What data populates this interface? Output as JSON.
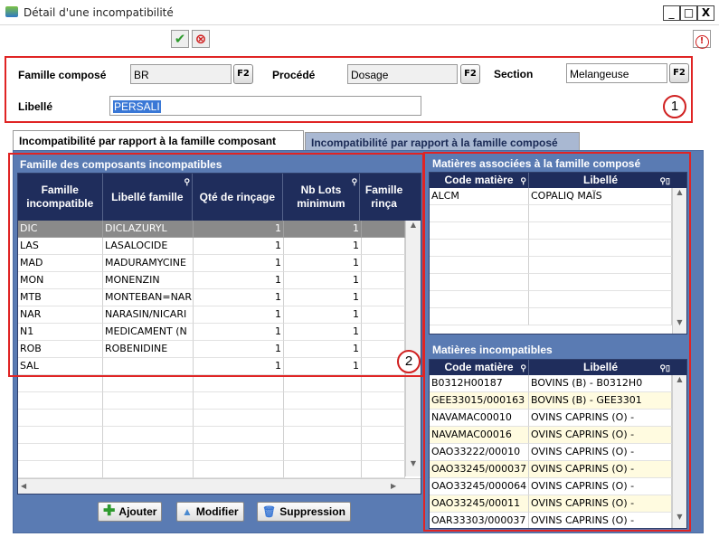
{
  "window": {
    "title": "Détail d'une incompatibilité",
    "minimize": "_",
    "maximize": "□",
    "close": "X"
  },
  "toolbar": {
    "validate_icon": "check-icon",
    "cancel_icon": "cancel-icon",
    "info_icon": "info-icon"
  },
  "header": {
    "famille_label": "Famille composé",
    "famille_value": "BR",
    "procede_label": "Procédé",
    "procede_value": "Dosage",
    "section_label": "Section",
    "section_value": "Melangeuse",
    "libelle_label": "Libellé",
    "libelle_value": "PERSALI",
    "f2": "F2",
    "badge1": "1",
    "badge2": "2"
  },
  "tabs": [
    {
      "label": "Incompatibilité par rapport à la famille composant",
      "active": true
    },
    {
      "label": "Incompatibilité par rapport à la famille composé",
      "active": false
    }
  ],
  "left_grid": {
    "title": "Famille des composants incompatibles",
    "columns": [
      "Famille incompatible",
      "Libellé famille",
      "Qté de rinçage",
      "Nb Lots minimum",
      "Famille rinça"
    ],
    "rows": [
      [
        "DIC",
        "DICLAZURYL",
        "1",
        "1"
      ],
      [
        "LAS",
        "LASALOCIDE",
        "1",
        "1"
      ],
      [
        "MAD",
        "MADURAMYCINE",
        "1",
        "1"
      ],
      [
        "MON",
        "MONENZIN",
        "1",
        "1"
      ],
      [
        "MTB",
        "MONTEBAN=NAR",
        "1",
        "1"
      ],
      [
        "NAR",
        "NARASIN/NICARI",
        "1",
        "1"
      ],
      [
        "N1",
        "MEDICAMENT (N",
        "1",
        "1"
      ],
      [
        "ROB",
        "ROBENIDINE",
        "1",
        "1"
      ],
      [
        "SAL",
        "",
        "1",
        "1"
      ]
    ]
  },
  "right_top_grid": {
    "title": "Matières associées à la famille composé",
    "columns": [
      "Code matière",
      "Libellé"
    ],
    "rows": [
      [
        "ALCM",
        "COPALIQ MAÏS"
      ]
    ]
  },
  "right_bottom_grid": {
    "title": "Matières incompatibles",
    "columns": [
      "Code matière",
      "Libellé"
    ],
    "rows": [
      [
        "B0312H00187",
        "BOVINS (B) - B0312H0"
      ],
      [
        "GEE33015/000163",
        "BOVINS (B) - GEE3301"
      ],
      [
        "NAVAMAC00010",
        "OVINS CAPRINS (O) -"
      ],
      [
        "NAVAMAC00016",
        "OVINS CAPRINS (O) -"
      ],
      [
        "OAO33222/00010",
        "OVINS CAPRINS (O) -"
      ],
      [
        "OAO33245/000037",
        "OVINS CAPRINS (O) -"
      ],
      [
        "OAO33245/000064",
        "OVINS CAPRINS (O) -"
      ],
      [
        "OAO33245/00011",
        "OVINS CAPRINS (O) -"
      ],
      [
        "OAR33303/000037",
        "OVINS CAPRINS (O) -"
      ]
    ]
  },
  "buttons": {
    "add": "Ajouter",
    "edit": "Modifier",
    "delete": "Suppression"
  }
}
